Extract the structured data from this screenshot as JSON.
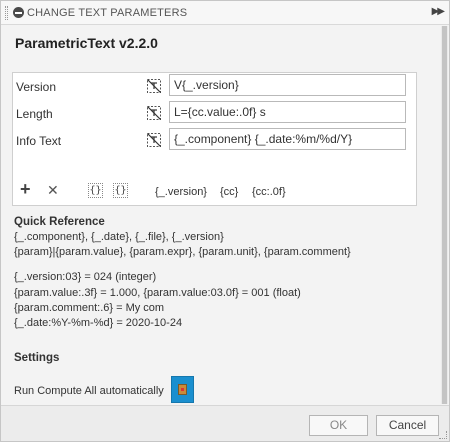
{
  "window": {
    "title": "CHANGE TEXT PARAMETERS"
  },
  "heading": "ParametricText v2.2.0",
  "params": [
    {
      "label": "Version",
      "value": "V{_.version}"
    },
    {
      "label": "Length",
      "value": "L={cc.value:.0f} s"
    },
    {
      "label": "Info Text",
      "value": "{_.component} {_.date:%m/%d/Y}"
    }
  ],
  "toolbar": {
    "add": "+",
    "delete": "✕",
    "insert_brace": "{}",
    "insert_brace_alt": "{}",
    "snippet_version": "{_.version}",
    "snippet_cc": "{cc}",
    "snippet_cc_format": "{cc:.0f}"
  },
  "quick_reference": {
    "title": "Quick Reference",
    "lines": [
      "{_.component}, {_.date}, {_.file}, {_.version}",
      "{param}|{param.value}, {param.expr}, {param.unit}, {param.comment}",
      "",
      "{_.version:03} = 024 (integer)",
      "{param.value:.3f} = 1.000, {param.value:03.0f} = 001 (float)",
      "{param.comment:.6} = My com",
      "{_.date:%Y-%m-%d} = 2020-10-24"
    ]
  },
  "settings": {
    "title": "Settings",
    "run_compute_label": "Run Compute All automatically",
    "run_compute_enabled": true
  },
  "buttons": {
    "ok": "OK",
    "cancel": "Cancel"
  },
  "colors": {
    "accent": "#1a8fcf"
  }
}
